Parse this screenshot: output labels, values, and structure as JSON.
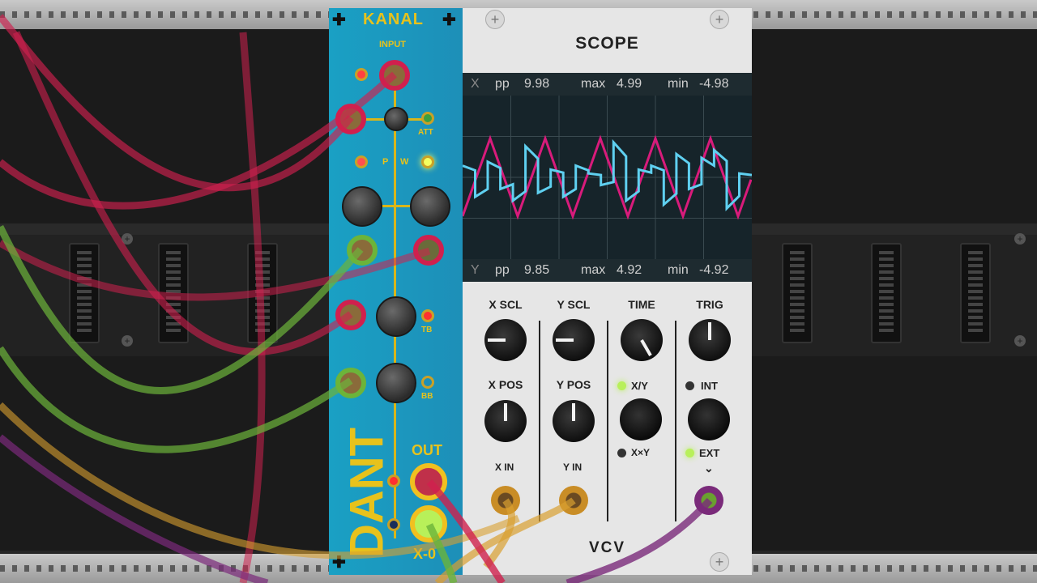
{
  "kanal": {
    "brand": "KANAL",
    "input_label": "INPUT",
    "att_label": "ATT",
    "p_label": "P",
    "w_label": "W",
    "tb_label": "TB",
    "bb_label": "BB",
    "out_label": "OUT",
    "product_name": "DANT",
    "footer_label": "X-0"
  },
  "scope": {
    "title": "SCOPE",
    "x_meas": {
      "channel": "X",
      "pp_label": "pp",
      "pp": "9.98",
      "max_label": "max",
      "max": "4.99",
      "min_label": "min",
      "min": "-4.98"
    },
    "y_meas": {
      "channel": "Y",
      "pp_label": "pp",
      "pp": "9.85",
      "max_label": "max",
      "max": "4.92",
      "min_label": "min",
      "min": "-4.92"
    },
    "controls": {
      "x_scl": "X SCL",
      "y_scl": "Y SCL",
      "time": "TIME",
      "trig": "TRIG",
      "x_pos": "X POS",
      "y_pos": "Y POS",
      "mode_xy": "X/Y",
      "mode_xxy": "X×Y",
      "trig_int": "INT",
      "trig_ext": "EXT",
      "x_in": "X IN",
      "y_in": "Y IN"
    },
    "logo": "VCV"
  },
  "colors": {
    "kanal_panel": "#1d9cc4",
    "kanal_accent": "#e7c21c",
    "trace_x": "#d81b7b",
    "trace_y": "#5fd0f0",
    "led_green": "#b8f05a",
    "led_red": "#ff3b3b"
  }
}
